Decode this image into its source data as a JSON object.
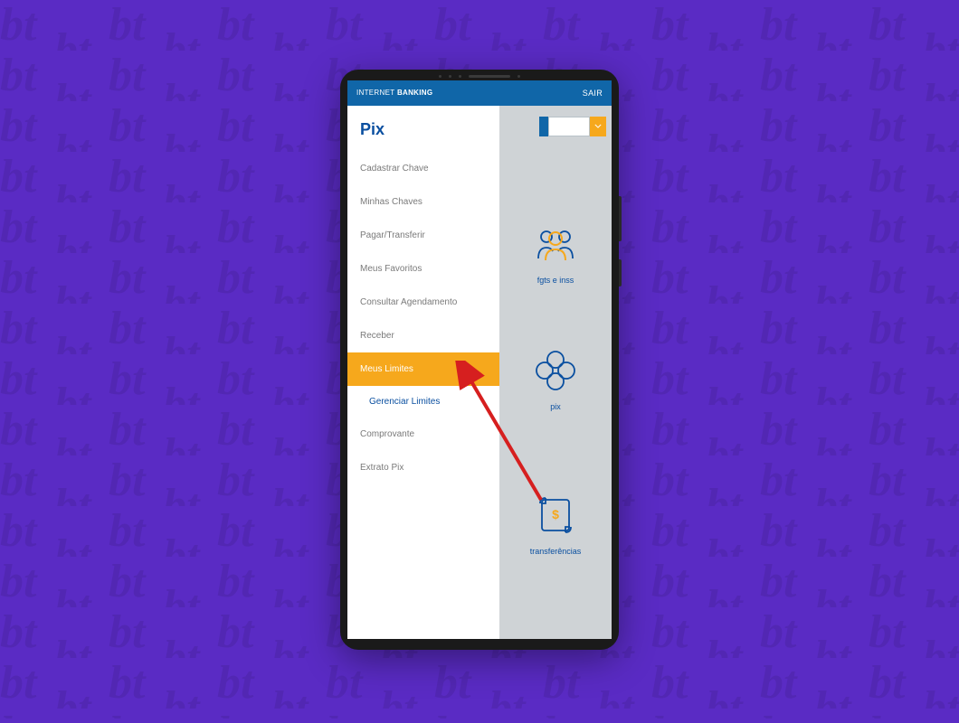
{
  "header": {
    "title_thin": "INTERNET",
    "title_bold": "BANKING",
    "exit_label": "SAIR"
  },
  "sidebar": {
    "title": "Pix",
    "items": [
      {
        "label": "Cadastrar Chave",
        "highlight": false
      },
      {
        "label": "Minhas Chaves",
        "highlight": false
      },
      {
        "label": "Pagar/Transferir",
        "highlight": false
      },
      {
        "label": "Meus Favoritos",
        "highlight": false
      },
      {
        "label": "Consultar Agendamento",
        "highlight": false
      },
      {
        "label": "Receber",
        "highlight": false
      },
      {
        "label": "Meus Limites",
        "highlight": true
      },
      {
        "label": "Gerenciar Limites",
        "sub": true
      },
      {
        "label": "Comprovante",
        "highlight": false
      },
      {
        "label": "Extrato Pix",
        "highlight": false
      }
    ]
  },
  "dashboard": {
    "items": [
      {
        "icon": "users-icon",
        "label": "fgts e inss"
      },
      {
        "icon": "pix-icon",
        "label": "pix"
      },
      {
        "icon": "transfer-icon",
        "label": "transferências"
      }
    ]
  },
  "colors": {
    "brand_purple": "#5a2bc4",
    "brand_blue": "#1066a8",
    "accent_orange": "#f6a81c",
    "text_blue": "#0a4fa0"
  }
}
